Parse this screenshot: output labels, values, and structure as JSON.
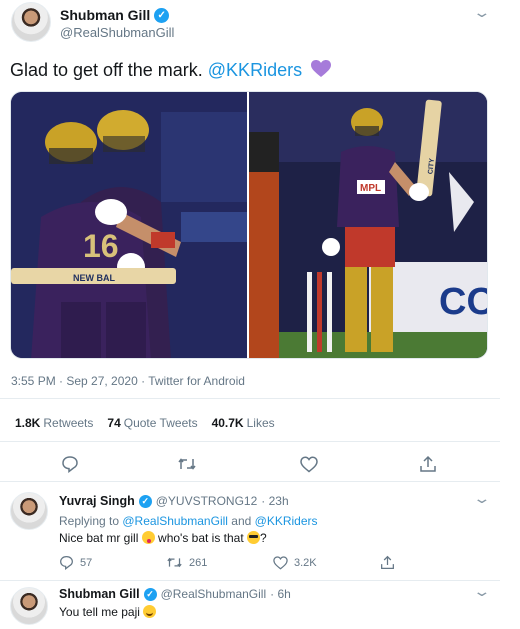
{
  "tweet": {
    "author_name": "Shubman Gill",
    "author_handle": "@RealShubmanGill",
    "text_before": "Glad to get off the mark. ",
    "text_mention": "@KKRiders",
    "emoji": "purple-heart",
    "meta": "3:55 PM · Sep 27, 2020 · Twitter for Android",
    "stats": {
      "retweets_count": "1.8K",
      "retweets_label": "Retweets",
      "quotes_count": "74",
      "quotes_label": "Quote Tweets",
      "likes_count": "40.7K",
      "likes_label": "Likes"
    },
    "photos": [
      {
        "description": "two-players-embracing",
        "jersey_number": "16",
        "bat_brand": "NEW BAL"
      },
      {
        "description": "player-raising-bat",
        "jersey_sponsor": "MPL",
        "bat_sticker": "CITY",
        "boundary_ad": "CO"
      }
    ]
  },
  "replies": [
    {
      "author_name": "Yuvraj Singh",
      "author_handle": "@YUVSTRONG12",
      "time": "· 23h",
      "replying_prefix": "Replying to ",
      "replying_to_1": "@RealShubmanGill",
      "replying_and": " and ",
      "replying_to_2": "@KKRiders",
      "text_part1": "Nice bat mr gill ",
      "text_part2": " who's bat is that ",
      "text_part3": "?",
      "reply_count": "57",
      "retweet_count": "261",
      "like_count": "3.2K"
    },
    {
      "author_name": "Shubman Gill",
      "author_handle": "@RealShubmanGill",
      "time": "· 6h",
      "text": "You tell me paji "
    }
  ],
  "colors": {
    "link": "#1b95e0",
    "verified": "#1da1f2",
    "heart": "#a67bda",
    "kkr_purple": "#3a225d",
    "kkr_gold": "#c9a227"
  }
}
